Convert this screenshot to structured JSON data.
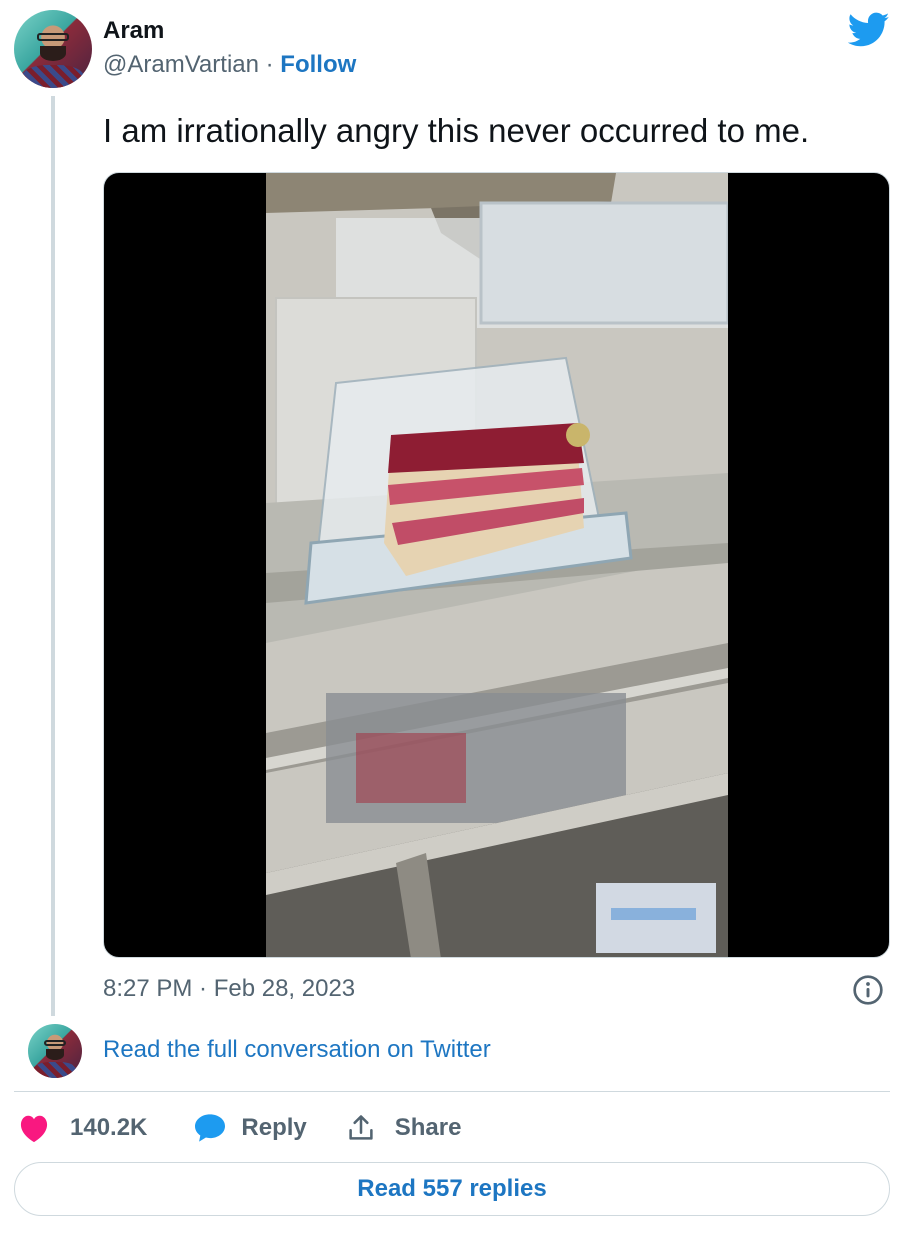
{
  "author": {
    "name": "Aram",
    "handle": "@AramVartian",
    "separator": " · ",
    "follow_label": "Follow"
  },
  "tweet": {
    "text": "I am irrationally angry this never occurred to me.",
    "timestamp": "8:27 PM · Feb 28, 2023"
  },
  "conversation_link": "Read the full conversation on Twitter",
  "actions": {
    "likes_count": "140.2K",
    "reply_label": "Reply",
    "share_label": "Share"
  },
  "read_replies_label": "Read 557 replies",
  "icons": {
    "brand": "twitter-bird-icon",
    "info": "info-icon",
    "like": "heart-icon",
    "reply": "speech-bubble-icon",
    "share": "share-upload-icon"
  },
  "colors": {
    "link": "#1d76c2",
    "twitter_blue": "#1d9bf0",
    "like_pink": "#f91880",
    "muted_text": "#536471",
    "border": "#cfd9de"
  }
}
